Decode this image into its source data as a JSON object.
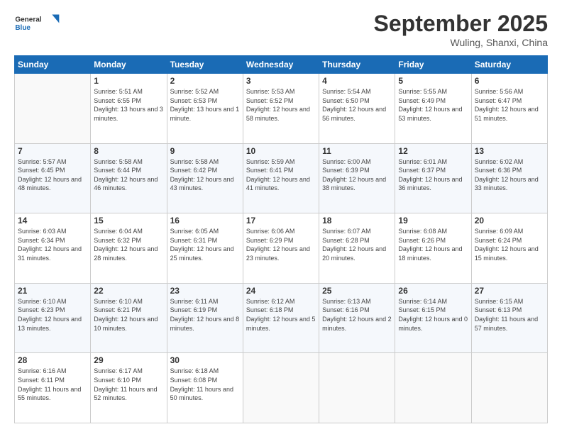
{
  "header": {
    "logo_general": "General",
    "logo_blue": "Blue",
    "month": "September 2025",
    "location": "Wuling, Shanxi, China"
  },
  "weekdays": [
    "Sunday",
    "Monday",
    "Tuesday",
    "Wednesday",
    "Thursday",
    "Friday",
    "Saturday"
  ],
  "weeks": [
    [
      {
        "day": "",
        "sunrise": "",
        "sunset": "",
        "daylight": ""
      },
      {
        "day": "1",
        "sunrise": "Sunrise: 5:51 AM",
        "sunset": "Sunset: 6:55 PM",
        "daylight": "Daylight: 13 hours and 3 minutes."
      },
      {
        "day": "2",
        "sunrise": "Sunrise: 5:52 AM",
        "sunset": "Sunset: 6:53 PM",
        "daylight": "Daylight: 13 hours and 1 minute."
      },
      {
        "day": "3",
        "sunrise": "Sunrise: 5:53 AM",
        "sunset": "Sunset: 6:52 PM",
        "daylight": "Daylight: 12 hours and 58 minutes."
      },
      {
        "day": "4",
        "sunrise": "Sunrise: 5:54 AM",
        "sunset": "Sunset: 6:50 PM",
        "daylight": "Daylight: 12 hours and 56 minutes."
      },
      {
        "day": "5",
        "sunrise": "Sunrise: 5:55 AM",
        "sunset": "Sunset: 6:49 PM",
        "daylight": "Daylight: 12 hours and 53 minutes."
      },
      {
        "day": "6",
        "sunrise": "Sunrise: 5:56 AM",
        "sunset": "Sunset: 6:47 PM",
        "daylight": "Daylight: 12 hours and 51 minutes."
      }
    ],
    [
      {
        "day": "7",
        "sunrise": "Sunrise: 5:57 AM",
        "sunset": "Sunset: 6:45 PM",
        "daylight": "Daylight: 12 hours and 48 minutes."
      },
      {
        "day": "8",
        "sunrise": "Sunrise: 5:58 AM",
        "sunset": "Sunset: 6:44 PM",
        "daylight": "Daylight: 12 hours and 46 minutes."
      },
      {
        "day": "9",
        "sunrise": "Sunrise: 5:58 AM",
        "sunset": "Sunset: 6:42 PM",
        "daylight": "Daylight: 12 hours and 43 minutes."
      },
      {
        "day": "10",
        "sunrise": "Sunrise: 5:59 AM",
        "sunset": "Sunset: 6:41 PM",
        "daylight": "Daylight: 12 hours and 41 minutes."
      },
      {
        "day": "11",
        "sunrise": "Sunrise: 6:00 AM",
        "sunset": "Sunset: 6:39 PM",
        "daylight": "Daylight: 12 hours and 38 minutes."
      },
      {
        "day": "12",
        "sunrise": "Sunrise: 6:01 AM",
        "sunset": "Sunset: 6:37 PM",
        "daylight": "Daylight: 12 hours and 36 minutes."
      },
      {
        "day": "13",
        "sunrise": "Sunrise: 6:02 AM",
        "sunset": "Sunset: 6:36 PM",
        "daylight": "Daylight: 12 hours and 33 minutes."
      }
    ],
    [
      {
        "day": "14",
        "sunrise": "Sunrise: 6:03 AM",
        "sunset": "Sunset: 6:34 PM",
        "daylight": "Daylight: 12 hours and 31 minutes."
      },
      {
        "day": "15",
        "sunrise": "Sunrise: 6:04 AM",
        "sunset": "Sunset: 6:32 PM",
        "daylight": "Daylight: 12 hours and 28 minutes."
      },
      {
        "day": "16",
        "sunrise": "Sunrise: 6:05 AM",
        "sunset": "Sunset: 6:31 PM",
        "daylight": "Daylight: 12 hours and 25 minutes."
      },
      {
        "day": "17",
        "sunrise": "Sunrise: 6:06 AM",
        "sunset": "Sunset: 6:29 PM",
        "daylight": "Daylight: 12 hours and 23 minutes."
      },
      {
        "day": "18",
        "sunrise": "Sunrise: 6:07 AM",
        "sunset": "Sunset: 6:28 PM",
        "daylight": "Daylight: 12 hours and 20 minutes."
      },
      {
        "day": "19",
        "sunrise": "Sunrise: 6:08 AM",
        "sunset": "Sunset: 6:26 PM",
        "daylight": "Daylight: 12 hours and 18 minutes."
      },
      {
        "day": "20",
        "sunrise": "Sunrise: 6:09 AM",
        "sunset": "Sunset: 6:24 PM",
        "daylight": "Daylight: 12 hours and 15 minutes."
      }
    ],
    [
      {
        "day": "21",
        "sunrise": "Sunrise: 6:10 AM",
        "sunset": "Sunset: 6:23 PM",
        "daylight": "Daylight: 12 hours and 13 minutes."
      },
      {
        "day": "22",
        "sunrise": "Sunrise: 6:10 AM",
        "sunset": "Sunset: 6:21 PM",
        "daylight": "Daylight: 12 hours and 10 minutes."
      },
      {
        "day": "23",
        "sunrise": "Sunrise: 6:11 AM",
        "sunset": "Sunset: 6:19 PM",
        "daylight": "Daylight: 12 hours and 8 minutes."
      },
      {
        "day": "24",
        "sunrise": "Sunrise: 6:12 AM",
        "sunset": "Sunset: 6:18 PM",
        "daylight": "Daylight: 12 hours and 5 minutes."
      },
      {
        "day": "25",
        "sunrise": "Sunrise: 6:13 AM",
        "sunset": "Sunset: 6:16 PM",
        "daylight": "Daylight: 12 hours and 2 minutes."
      },
      {
        "day": "26",
        "sunrise": "Sunrise: 6:14 AM",
        "sunset": "Sunset: 6:15 PM",
        "daylight": "Daylight: 12 hours and 0 minutes."
      },
      {
        "day": "27",
        "sunrise": "Sunrise: 6:15 AM",
        "sunset": "Sunset: 6:13 PM",
        "daylight": "Daylight: 11 hours and 57 minutes."
      }
    ],
    [
      {
        "day": "28",
        "sunrise": "Sunrise: 6:16 AM",
        "sunset": "Sunset: 6:11 PM",
        "daylight": "Daylight: 11 hours and 55 minutes."
      },
      {
        "day": "29",
        "sunrise": "Sunrise: 6:17 AM",
        "sunset": "Sunset: 6:10 PM",
        "daylight": "Daylight: 11 hours and 52 minutes."
      },
      {
        "day": "30",
        "sunrise": "Sunrise: 6:18 AM",
        "sunset": "Sunset: 6:08 PM",
        "daylight": "Daylight: 11 hours and 50 minutes."
      },
      {
        "day": "",
        "sunrise": "",
        "sunset": "",
        "daylight": ""
      },
      {
        "day": "",
        "sunrise": "",
        "sunset": "",
        "daylight": ""
      },
      {
        "day": "",
        "sunrise": "",
        "sunset": "",
        "daylight": ""
      },
      {
        "day": "",
        "sunrise": "",
        "sunset": "",
        "daylight": ""
      }
    ]
  ]
}
